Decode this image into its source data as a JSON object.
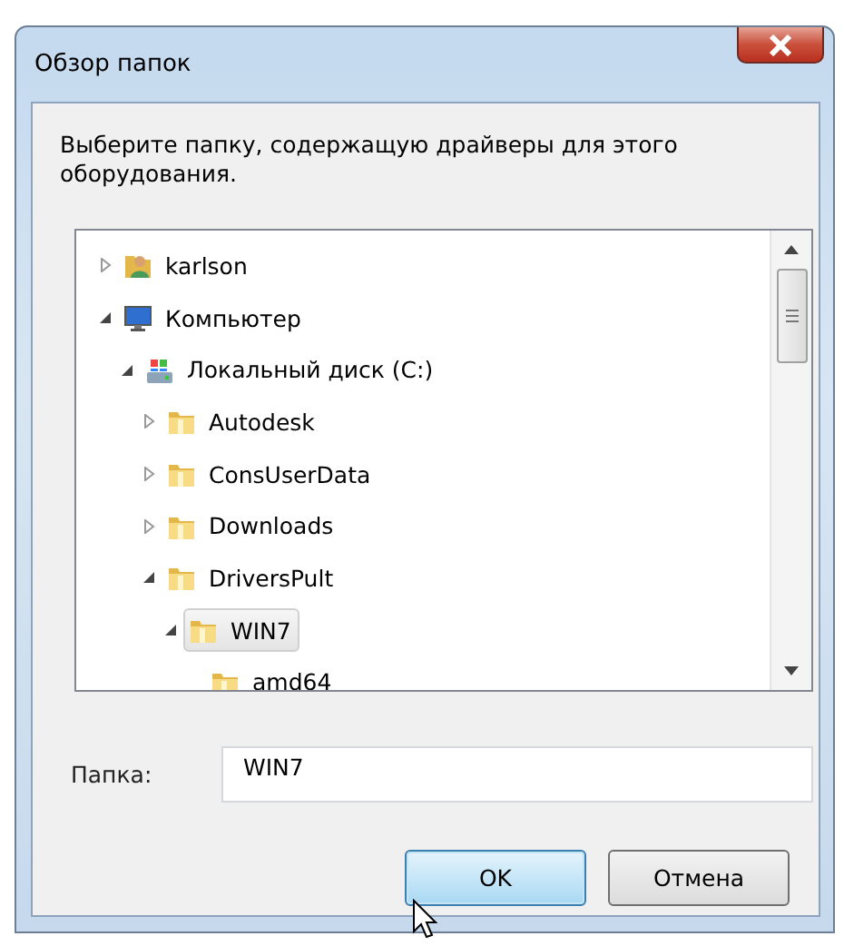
{
  "window": {
    "title": "Обзор папок"
  },
  "description": "Выберите папку, содержащую драйверы для этого оборудования.",
  "tree": [
    {
      "label": "karlson",
      "kind": "user",
      "expanded": false,
      "selected": false
    },
    {
      "label": "Компьютер",
      "kind": "computer",
      "expanded": true,
      "selected": false,
      "children": [
        {
          "label": "Локальный диск (C:)",
          "kind": "drive",
          "expanded": true,
          "selected": false,
          "children": [
            {
              "label": "Autodesk",
              "kind": "folder",
              "expanded": false,
              "selected": false
            },
            {
              "label": "ConsUserData",
              "kind": "folder",
              "expanded": false,
              "selected": false
            },
            {
              "label": "Downloads",
              "kind": "folder",
              "expanded": false,
              "selected": false
            },
            {
              "label": "DriversPult",
              "kind": "folder",
              "expanded": true,
              "selected": false,
              "children": [
                {
                  "label": "WIN7",
                  "kind": "folder",
                  "expanded": true,
                  "selected": true,
                  "children": [
                    {
                      "label": "amd64",
                      "kind": "folder",
                      "selected": false
                    }
                  ]
                }
              ]
            }
          ]
        }
      ]
    }
  ],
  "folder_field": {
    "label": "Папка:",
    "value": "WIN7"
  },
  "buttons": [
    {
      "label": "OK",
      "kind": "default"
    },
    {
      "label": "Отмена",
      "kind": "normal"
    }
  ]
}
